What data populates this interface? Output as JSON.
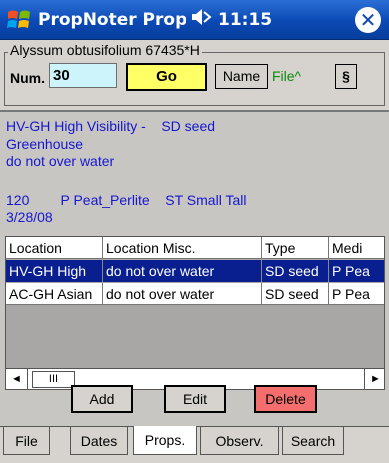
{
  "titlebar": {
    "app_title": "PropNoter Propagatio",
    "speaker_icon": "’◄",
    "clock": "11:15",
    "close_label": "✕"
  },
  "form": {
    "group_title": "Alyssum obtusifolium 67435*H",
    "num_label": "Num.",
    "num_value": "30",
    "go_label": "Go",
    "name_label": "Name",
    "file_link": "File^",
    "section_label": "§"
  },
  "details": {
    "line1": "HV-GH High Visibility -    SD seed",
    "line2": "Greenhouse",
    "line3": "do not over water",
    "info1": "120        P Peat_Perlite    ST Small Tall",
    "info2": "3/28/08"
  },
  "table": {
    "columns": [
      "Location",
      "Location Misc.",
      "Type",
      "Medi"
    ],
    "rows": [
      [
        "HV-GH High",
        "do not over water",
        "SD seed",
        "P Pea"
      ],
      [
        "AC-GH Asian",
        "do not over water",
        "SD seed",
        "P Pea"
      ]
    ],
    "scroll_left": "◄",
    "scroll_thumb": "III",
    "scroll_right": "►"
  },
  "actions": {
    "add": "Add",
    "edit": "Edit",
    "delete": "Delete"
  },
  "tabs": [
    {
      "label": "File"
    },
    {
      "label": "Dates"
    },
    {
      "label": "Props."
    },
    {
      "label": "Observ."
    },
    {
      "label": "Search"
    }
  ],
  "colors": {
    "title_bar": "#0b49b4",
    "num_field": "#cdf4fb",
    "go_button": "#ffff66",
    "delete_button": "#f46e6e",
    "selected_row": "#0a1f8f",
    "detail_text": "#1616d0",
    "file_link": "#0a8a0a"
  }
}
